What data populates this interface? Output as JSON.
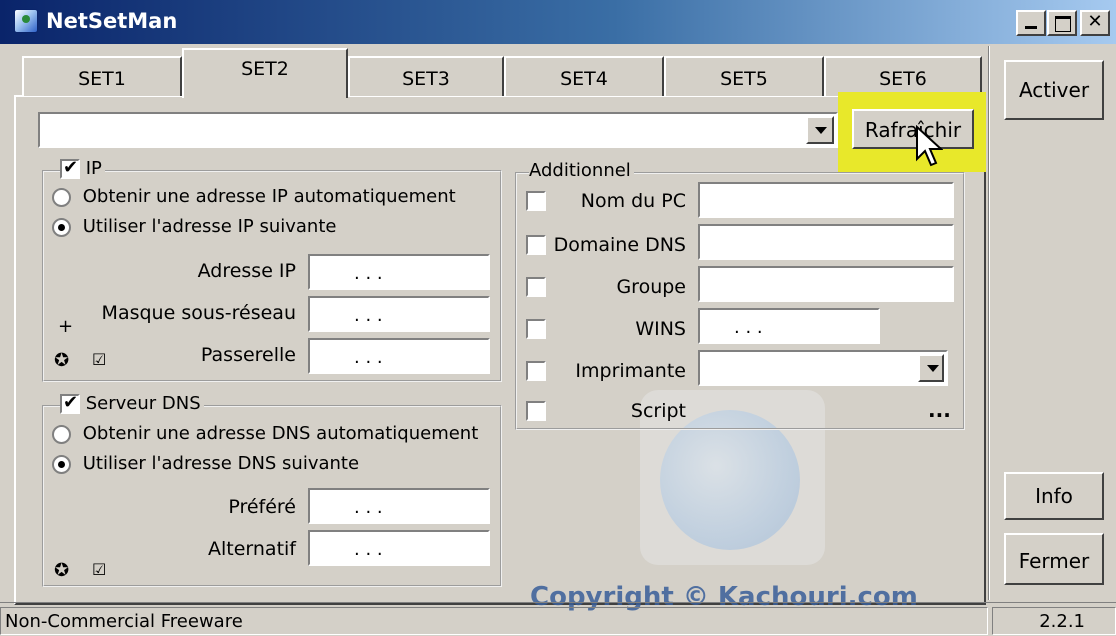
{
  "window": {
    "title": "NetSetMan",
    "icon": "netsetman-app-icon"
  },
  "titlebar_buttons": [
    "minimize",
    "maximize",
    "close"
  ],
  "tabs": [
    {
      "label": "SET1",
      "active": false
    },
    {
      "label": "SET2",
      "active": true
    },
    {
      "label": "SET3",
      "active": false
    },
    {
      "label": "SET4",
      "active": false
    },
    {
      "label": "SET5",
      "active": false
    },
    {
      "label": "SET6",
      "active": false
    }
  ],
  "profile_combo": {
    "value": ""
  },
  "refresh_button": {
    "label": "Rafraîchir"
  },
  "side_buttons": {
    "activate": "Activer",
    "info": "Info",
    "close": "Fermer"
  },
  "ip_group": {
    "title": "IP",
    "checked": true,
    "radio_auto": "Obtenir une adresse IP automatiquement",
    "radio_manual": "Utiliser l'adresse IP suivante",
    "selected": "manual",
    "fields": [
      {
        "label": "Adresse IP",
        "value": ". . ."
      },
      {
        "label": "Masque sous-réseau",
        "value": ". . ."
      },
      {
        "label": "Passerelle",
        "value": ". . ."
      }
    ],
    "plus": "+",
    "small_icons": [
      "circle-icon",
      "checkbox-icon"
    ]
  },
  "dns_group": {
    "title": "Serveur DNS",
    "checked": true,
    "radio_auto": "Obtenir une adresse DNS automatiquement",
    "radio_manual": "Utiliser l'adresse DNS suivante",
    "selected": "manual",
    "fields": [
      {
        "label": "Préféré",
        "value": ". . ."
      },
      {
        "label": "Alternatif",
        "value": ". . ."
      }
    ]
  },
  "additional_group": {
    "title": "Additionnel",
    "rows": [
      {
        "label": "Nom du PC",
        "value": ""
      },
      {
        "label": "Domaine DNS",
        "value": ""
      },
      {
        "label": "Groupe",
        "value": ""
      },
      {
        "label": "WINS",
        "value": ". . ."
      },
      {
        "label": "Imprimante",
        "value": ""
      },
      {
        "label": "Script",
        "value": "..."
      }
    ]
  },
  "watermark": "Copyright © Kachouri.com",
  "status": {
    "left": "Non-Commercial Freeware",
    "right": "2.2.1"
  },
  "colors": {
    "highlight": "#e8e82a",
    "title_gradient_start": "#0a246a",
    "title_gradient_end": "#a6caf0"
  }
}
